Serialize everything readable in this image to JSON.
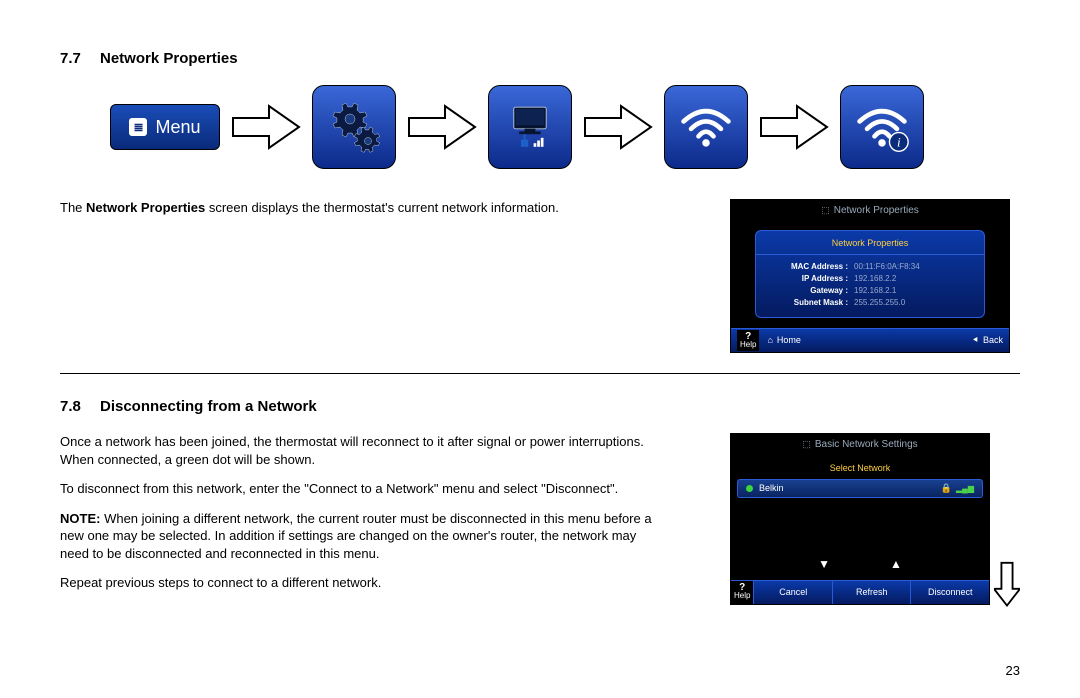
{
  "section1": {
    "num": "7.7",
    "title": "Network Properties"
  },
  "section2": {
    "num": "7.8",
    "title": "Disconnecting from a Network"
  },
  "menu_label": "Menu",
  "body77_pre": "The ",
  "body77_bold": "Network Properties",
  "body77_post": " screen displays the thermostat's current network information.",
  "body78_p1": "Once a network has been joined, the thermostat will reconnect to it after signal or power interruptions. When connected, a green dot will be shown.",
  "body78_p2": "To disconnect from this network, enter the \"Connect to a Network\" menu and select \"Disconnect\".",
  "body78_note_label": "NOTE:",
  "body78_note_text": " When joining a different network, the current router must be disconnected in this menu before a new one may be selected. In addition if settings are changed on the owner's router, the network may need to be disconnected and reconnected in this menu.",
  "body78_p3": "Repeat previous steps to connect to a different network.",
  "page_number": "23",
  "shot1": {
    "header": "Network Properties",
    "panel_title": "Network Properties",
    "rows": [
      {
        "label": "MAC Address :",
        "val": "00:11:F6:0A:F8:34"
      },
      {
        "label": "IP Address :",
        "val": "192.168.2.2"
      },
      {
        "label": "Gateway :",
        "val": "192.168.2.1"
      },
      {
        "label": "Subnet Mask :",
        "val": "255.255.255.0"
      }
    ],
    "help_q": "?",
    "help_label": "Help",
    "home_icon": "⌂",
    "home_label": "Home",
    "back_icon": "⯇",
    "back_label": "Back"
  },
  "shot2": {
    "header": "Basic Network Settings",
    "select_title": "Select Network",
    "item_name": "Belkin",
    "lock": "🔒",
    "signal": "▂▄▆",
    "arrow_down": "▼",
    "arrow_up": "▲",
    "help_q": "?",
    "help_label": "Help",
    "btn1": "Cancel",
    "btn2": "Refresh",
    "btn3": "Disconnect"
  }
}
